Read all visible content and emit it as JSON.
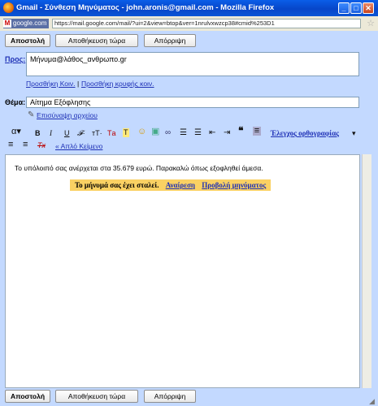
{
  "window": {
    "title": "Gmail - Σύνθεση Μηνύματος - john.aronis@gmail.com - Mozilla Firefox",
    "minimize": "_",
    "maximize": "□",
    "close": "✕"
  },
  "address": {
    "site": "google.com",
    "site_icon": "M",
    "url": "https://mail.google.com/mail/?ui=2&view=btop&ver=1nrulvxwzcp38#cmid%253D1"
  },
  "toolbar_top": {
    "send": "Αποστολή",
    "save": "Αποθήκευση τώρα",
    "discard": "Απόρριψη"
  },
  "toolbar_bottom": {
    "send": "Αποστολή",
    "save": "Αποθήκευση τώρα",
    "discard": "Απόρριψη"
  },
  "to": {
    "label": "Προς:",
    "value": "Μήνυμα@λάθος_ανθρωπο.gr"
  },
  "cc_links": {
    "add_cc": "Προσθήκη Κοιν.",
    "separator": "|",
    "add_bcc": "Προσθήκη κρυφής κοιν."
  },
  "subject": {
    "label": "Θέμα:",
    "value": "Αίτημα Εξόφλησης"
  },
  "attach": {
    "label": "Επισύναψη αρχείου"
  },
  "format": {
    "font": "α",
    "font_arrow": "▾",
    "bold": "B",
    "italic": "I",
    "underline": "U",
    "font_face": "𝓕·",
    "size": "тT·",
    "text_color": "Tа",
    "highlight": "T",
    "emoji": "☺",
    "image": "▣",
    "link": "∞",
    "numbered_list": "☰",
    "bulleted_list": "☰",
    "outdent": "⇤",
    "indent": "⇥",
    "quote": "❝",
    "align": "≡",
    "align_left": "≡",
    "align_right": "≡",
    "remove_format": "Tx",
    "spell_check": "Έλεγχος ορθογραφίας",
    "spell_arrow": "▾",
    "plain_text": "« Απλό Κείμενο"
  },
  "body": {
    "text": "Το υπόλοιπό σας ανέρχεται στα 35.679 ευρώ. Παρακαλώ όπως εξοφληθεί άμεσα."
  },
  "notice": {
    "message": "Το μήνυμά σας έχει σταλεί.",
    "undo": "Αναίρεση",
    "view": "Προβολή μηνύματος"
  }
}
